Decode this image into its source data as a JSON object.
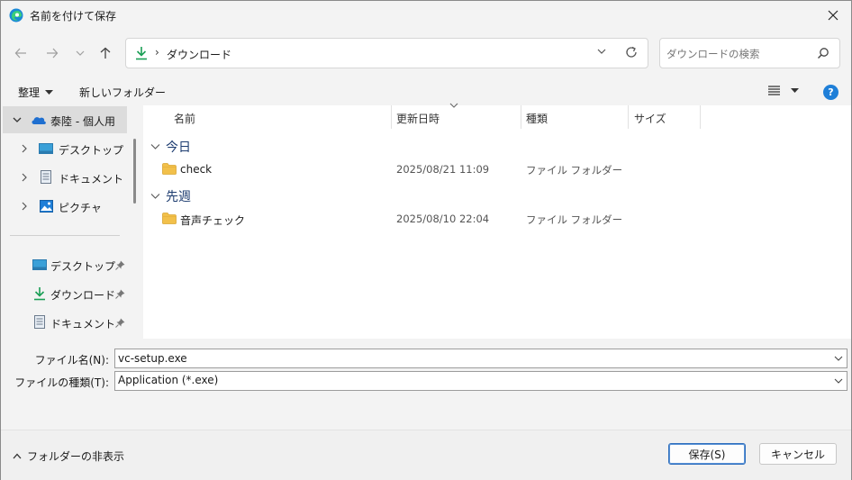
{
  "window": {
    "title": "名前を付けて保存"
  },
  "nav": {
    "address_path": "ダウンロード",
    "search_placeholder": "ダウンロードの検索"
  },
  "toolbar": {
    "organize_label": "整理",
    "new_folder_label": "新しいフォルダー",
    "help_label": "?"
  },
  "sidebar": {
    "items": [
      {
        "label": "泰陸 - 個人用",
        "icon": "onedrive-cloud-icon"
      },
      {
        "label": "デスクトップ",
        "icon": "desktop-icon"
      },
      {
        "label": "ドキュメント",
        "icon": "document-icon"
      },
      {
        "label": "ピクチャ",
        "icon": "picture-icon"
      }
    ],
    "pinned": [
      {
        "label": "デスクトップ",
        "icon": "desktop-icon"
      },
      {
        "label": "ダウンロード",
        "icon": "download-icon"
      },
      {
        "label": "ドキュメント",
        "icon": "document-icon"
      }
    ]
  },
  "filelist": {
    "columns": [
      "名前",
      "更新日時",
      "種類",
      "サイズ"
    ],
    "groups": [
      {
        "label": "今日",
        "files": [
          {
            "name": "check",
            "modified": "2025/08/21 11:09",
            "type": "ファイル フォルダー"
          }
        ]
      },
      {
        "label": "先週",
        "files": [
          {
            "name": "音声チェック",
            "modified": "2025/08/10 22:04",
            "type": "ファイル フォルダー"
          }
        ]
      }
    ]
  },
  "form": {
    "filename_label": "ファイル名(N):",
    "filename_value": "vc-setup.exe",
    "filetype_label": "ファイルの種類(T):",
    "filetype_value": "Application (*.exe)"
  },
  "footer": {
    "hide_folders_label": "フォルダーの非表示",
    "save_label": "保存(S)",
    "cancel_label": "キャンセル"
  },
  "colors": {
    "accent": "#1f7fd8",
    "folder": "#f2c04a",
    "download_green": "#1a9e55"
  }
}
